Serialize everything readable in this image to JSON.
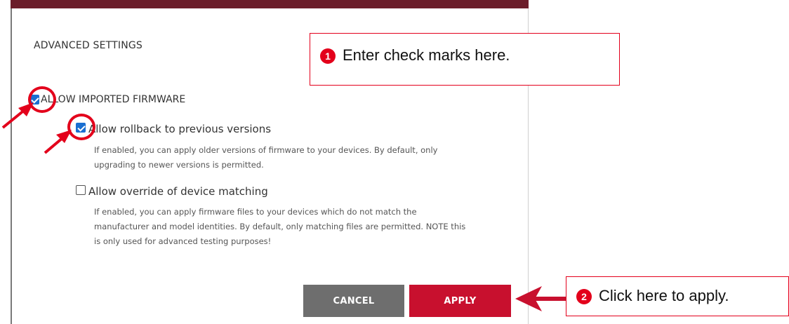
{
  "dialog": {
    "title": "ADVANCED SETTINGS",
    "main_option": {
      "label": "ALLOW IMPORTED FIRMWARE",
      "checked": true
    },
    "options": [
      {
        "label": "Allow rollback to previous versions",
        "checked": true,
        "description_lines": [
          "If enabled, you can apply older versions of firmware to your devices. By default, only",
          "upgrading to newer versions is permitted."
        ]
      },
      {
        "label": "Allow override of device matching",
        "checked": false,
        "description_lines": [
          "If enabled, you can apply firmware files to your devices which do not match the",
          "manufacturer and model identities. By default, only matching files are permitted. NOTE this",
          "is only used for advanced testing purposes!"
        ]
      }
    ],
    "buttons": {
      "cancel": "CANCEL",
      "apply": "APPLY"
    }
  },
  "annotations": {
    "callout1": {
      "number": "1",
      "text": "Enter check marks here."
    },
    "callout2": {
      "number": "2",
      "text": "Click here to apply."
    }
  },
  "colors": {
    "accent_red": "#c8102e",
    "annotation_red": "#e3001b",
    "checkbox_blue": "#1a6fd1",
    "cancel_gray": "#6e6e6e",
    "top_bar": "#6b1d2a"
  },
  "icons": [
    "checkbox-checked",
    "checkbox-unchecked",
    "red-arrow-icon",
    "red-circle-highlight"
  ]
}
